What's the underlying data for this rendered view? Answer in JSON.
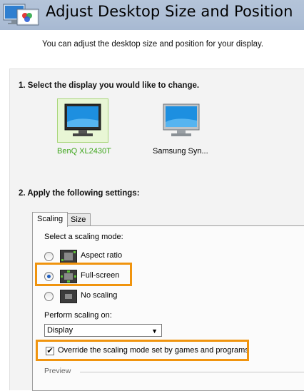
{
  "header": {
    "title": "Adjust Desktop Size and Position",
    "icon": "nvidia-display-icon"
  },
  "subtitle": "You can adjust the desktop size and position for your display.",
  "step1": {
    "title": "1. Select the display you would like to change.",
    "displays": [
      {
        "label": "BenQ XL2430T",
        "selected": true
      },
      {
        "label": "Samsung Syn...",
        "selected": false
      }
    ]
  },
  "step2": {
    "title": "2. Apply the following settings:",
    "tabs": [
      {
        "label": "Scaling",
        "active": true
      },
      {
        "label": "Size",
        "active": false
      }
    ],
    "scaling": {
      "mode_prompt": "Select a scaling mode:",
      "modes": [
        {
          "label": "Aspect ratio",
          "checked": false
        },
        {
          "label": "Full-screen",
          "checked": true
        },
        {
          "label": "No scaling",
          "checked": false
        }
      ],
      "perform_on_label": "Perform scaling on:",
      "perform_on_value": "Display",
      "override_label": "Override the scaling mode set by games and programs",
      "override_checked": true,
      "preview_label": "Preview"
    }
  },
  "colors": {
    "header_bg": "#aebfd6",
    "highlight": "#f0940e",
    "selected_display_bg": "#e8f6d5",
    "selected_display_text": "#3da51a"
  }
}
